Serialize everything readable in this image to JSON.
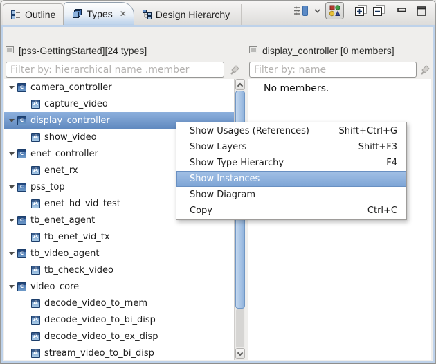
{
  "tabs": [
    {
      "label": "Outline"
    },
    {
      "label": "Types",
      "active": true
    },
    {
      "label": "Design Hierarchy"
    }
  ],
  "icons": {
    "tab_close": "✕",
    "tree_glyphs": {
      "component": "c",
      "action": "A"
    }
  },
  "left_panel": {
    "header": "[pss-GettingStarted][24 types]",
    "filter_placeholder": "Filter by: hierarchical name .member",
    "tree": [
      {
        "label": "camera_controller",
        "kind": "component",
        "level": 0,
        "expanded": true
      },
      {
        "label": "capture_video",
        "kind": "action",
        "level": 1
      },
      {
        "label": "display_controller",
        "kind": "component",
        "level": 0,
        "expanded": true,
        "selected": true
      },
      {
        "label": "show_video",
        "kind": "action",
        "level": 1
      },
      {
        "label": "enet_controller",
        "kind": "component",
        "level": 0,
        "expanded": true
      },
      {
        "label": "enet_rx",
        "kind": "action",
        "level": 1
      },
      {
        "label": "pss_top",
        "kind": "component",
        "level": 0,
        "expanded": true
      },
      {
        "label": "enet_hd_vid_test",
        "kind": "action",
        "level": 1
      },
      {
        "label": "tb_enet_agent",
        "kind": "component",
        "level": 0,
        "expanded": true
      },
      {
        "label": "tb_enet_vid_tx",
        "kind": "action",
        "level": 1
      },
      {
        "label": "tb_video_agent",
        "kind": "component",
        "level": 0,
        "expanded": true
      },
      {
        "label": "tb_check_video",
        "kind": "action",
        "level": 1
      },
      {
        "label": "video_core",
        "kind": "component",
        "level": 0,
        "expanded": true
      },
      {
        "label": "decode_video_to_mem",
        "kind": "action",
        "level": 1
      },
      {
        "label": "decode_video_to_bi_disp",
        "kind": "action",
        "level": 1
      },
      {
        "label": "decode_video_to_ex_disp",
        "kind": "action",
        "level": 1
      },
      {
        "label": "stream_video_to_bi_disp",
        "kind": "action",
        "level": 1
      }
    ]
  },
  "right_panel": {
    "header": "display_controller [0 members]",
    "filter_placeholder": "Filter by: name",
    "empty_message": "No members."
  },
  "context_menu": {
    "items": [
      {
        "label": "Show Usages (References)",
        "shortcut": "Shift+Ctrl+G"
      },
      {
        "label": "Show Layers",
        "shortcut": "Shift+F3"
      },
      {
        "label": "Show Type Hierarchy",
        "shortcut": "F4"
      },
      {
        "label": "Show Instances",
        "shortcut": "",
        "highlighted": true
      },
      {
        "label": "Show Diagram",
        "shortcut": ""
      },
      {
        "label": "Copy",
        "shortcut": "Ctrl+C"
      }
    ]
  },
  "colors": {
    "selection_top": "#8db0dd",
    "selection_bottom": "#6089bf",
    "menu_highlight": "#7da4d5",
    "frame_blue": "#bed2ea",
    "icon_navy": "#1c3e6b",
    "active_tab_bottom": "#b9d0ea"
  }
}
